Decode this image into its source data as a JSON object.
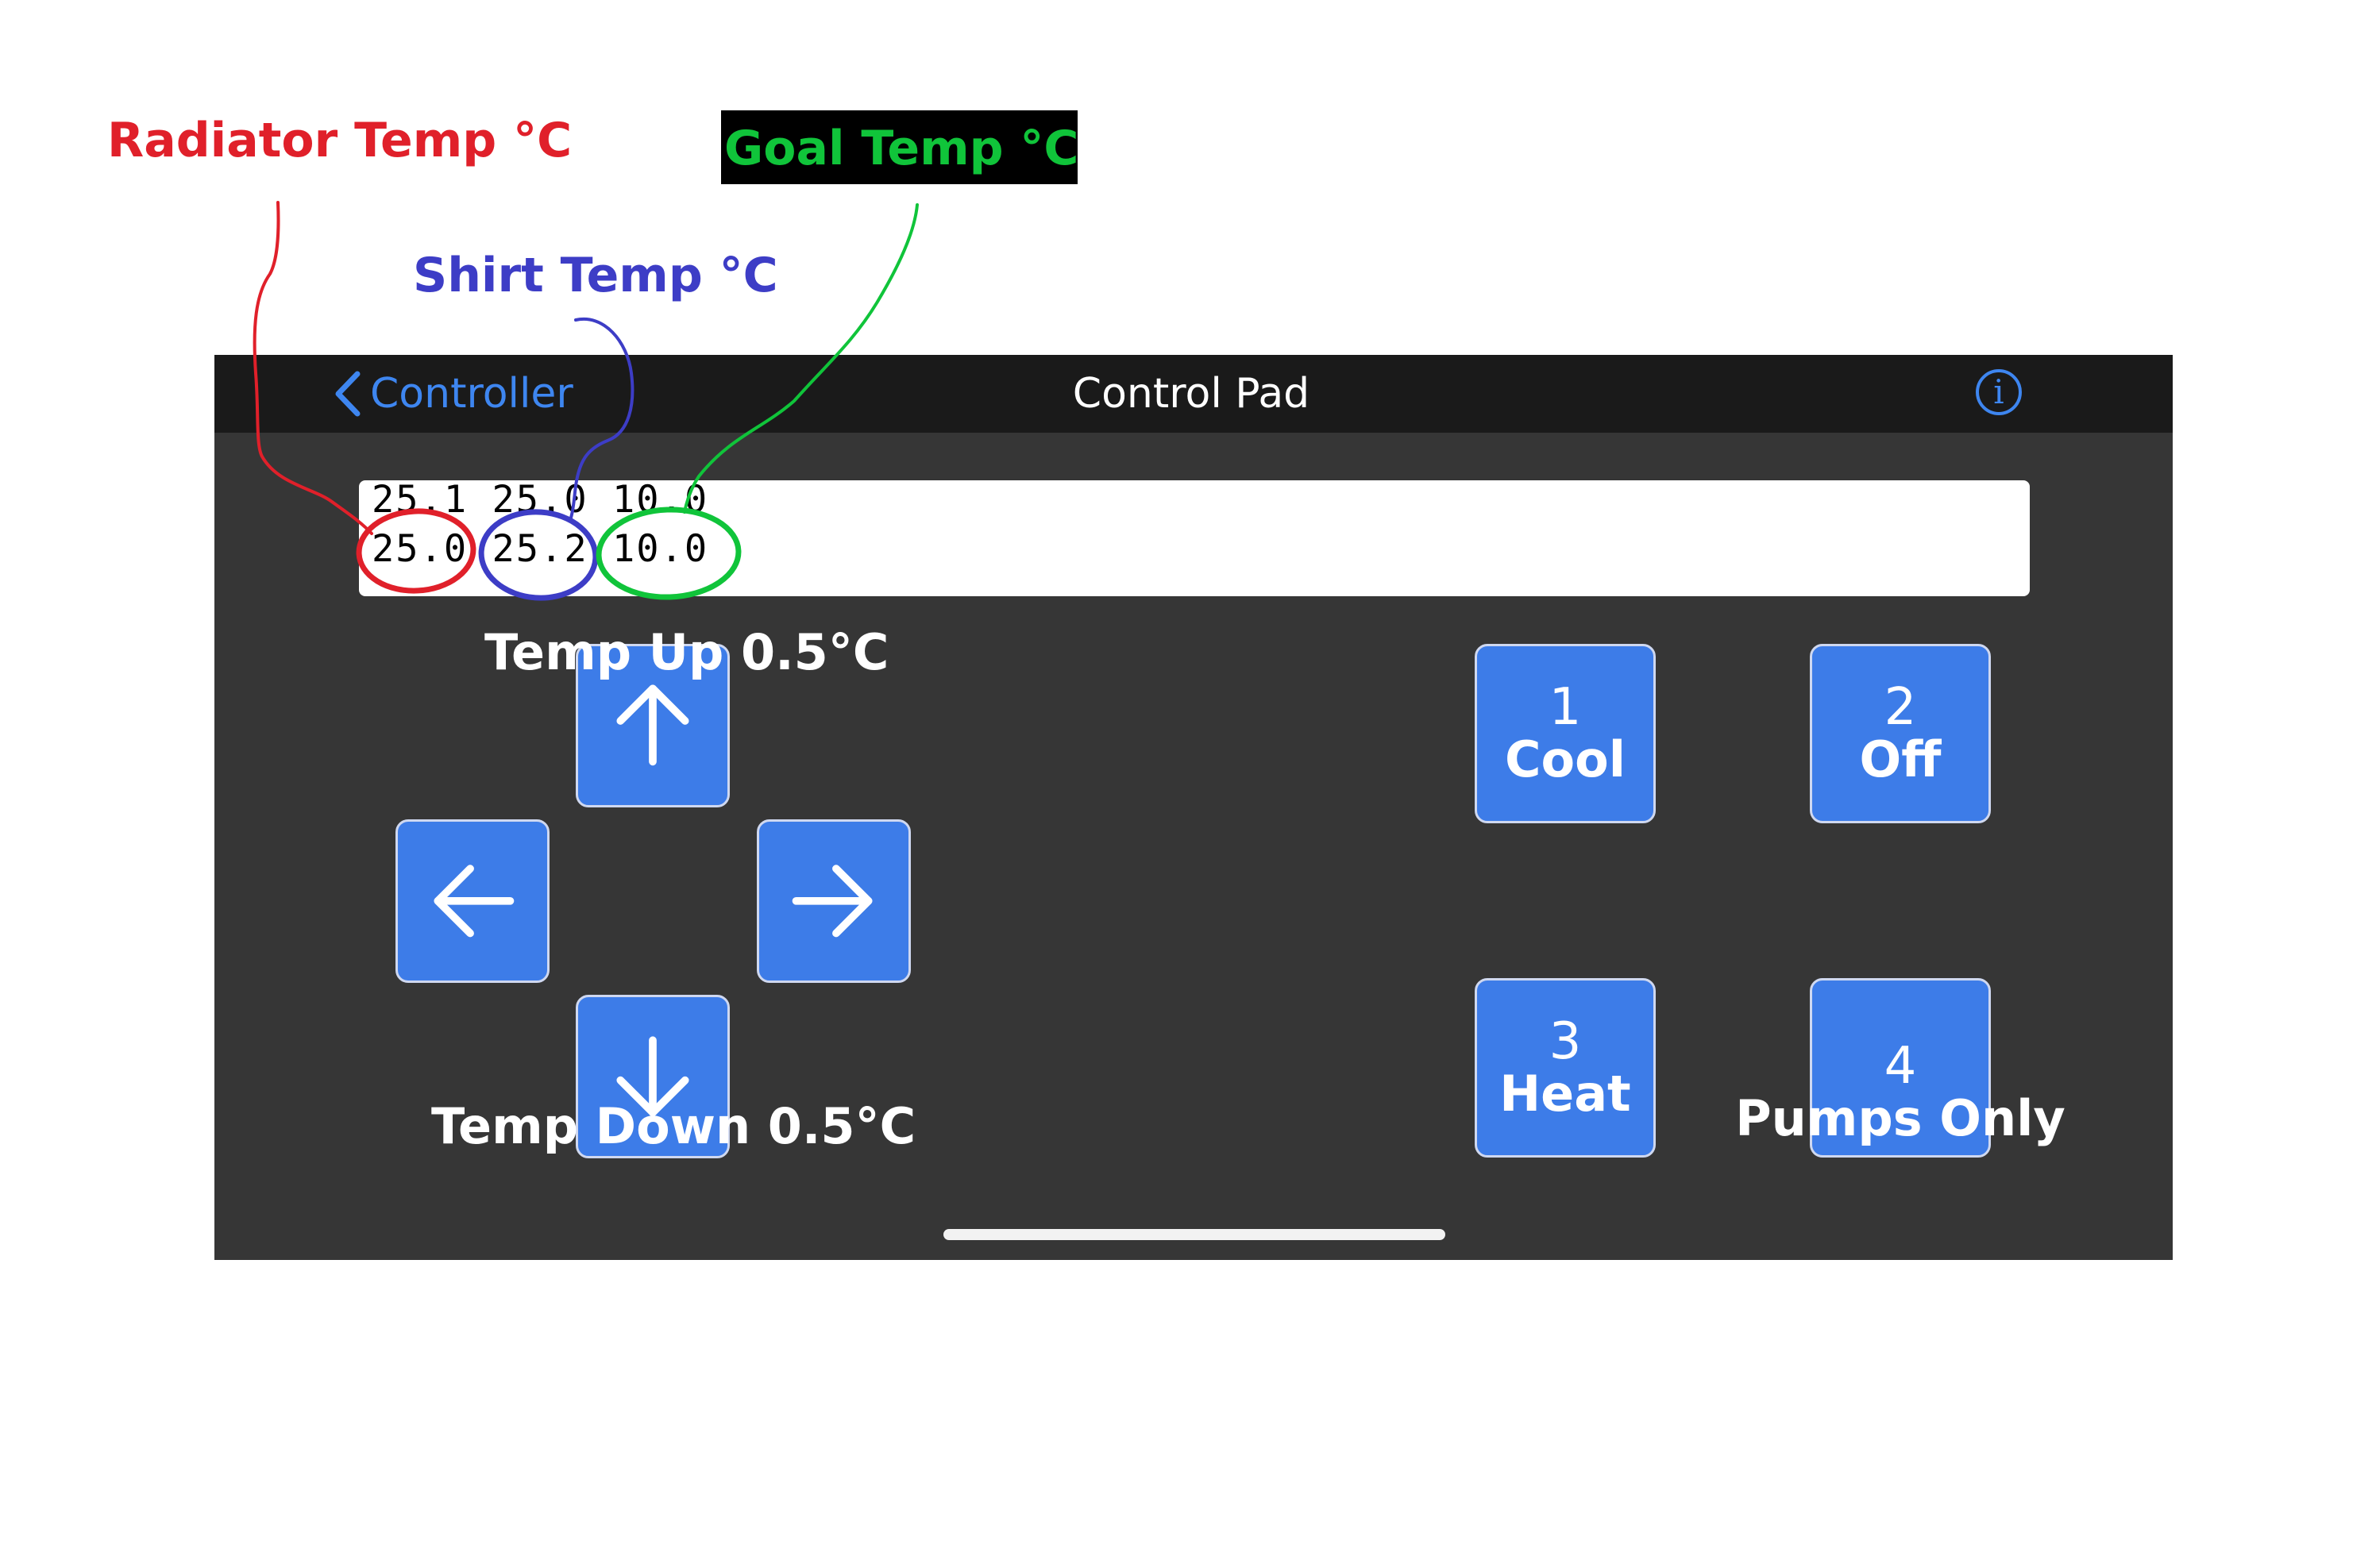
{
  "annotations": {
    "radiator_label": "Radiator Temp °C",
    "shirt_label": "Shirt Temp °C",
    "goal_label": "Goal Temp °C",
    "colors": {
      "radiator": "#e0202a",
      "shirt": "#3d3dc6",
      "goal": "#10c43a"
    }
  },
  "navbar": {
    "back_label": "Controller",
    "title": "Control Pad",
    "info_icon": "info-icon"
  },
  "display": {
    "line1": "25.1 25.0 10.0",
    "line2": {
      "radiator": "25.0",
      "shirt": "25.2",
      "goal": "10.0"
    }
  },
  "dpad": {
    "up_caption": "Temp Up 0.5°C",
    "down_caption": "Temp Down 0.5°C",
    "icons": [
      "arrow-up-icon",
      "arrow-left-icon",
      "arrow-right-icon",
      "arrow-down-icon"
    ]
  },
  "modes": [
    {
      "number": "1",
      "label": "Cool"
    },
    {
      "number": "2",
      "label": "Off"
    },
    {
      "number": "3",
      "label": "Heat"
    },
    {
      "number": "4",
      "label": "Pumps Only"
    }
  ],
  "colors": {
    "button": "#3d7ce8",
    "accent": "#3e86f0",
    "screen": "#363636",
    "navbar": "#1a1a1a"
  }
}
